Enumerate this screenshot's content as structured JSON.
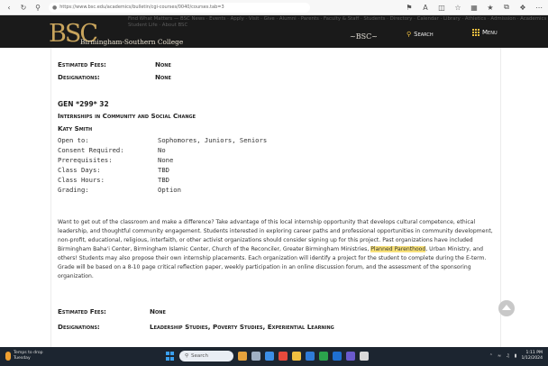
{
  "browser": {
    "url": "https://www.bsc.edu/academics/bulletin/cgi-courses/0040/courses.tab=3",
    "icons": [
      "back-icon",
      "refresh-icon",
      "translate-icon",
      "favorite-icon",
      "collections-icon",
      "split-icon",
      "favorites-bar-icon",
      "extensions-icon",
      "more-icon"
    ]
  },
  "header": {
    "ghost_text": "Find What Matters — BSC News · Events · Apply · Visit · Give · Alumni · Parents · Faculty & Staff · Students · Directory · Calendar · Library · Athletics · Admission · Academics · Student Life · About BSC",
    "logo": "BSC",
    "college_name": "Birmingham-Southern College",
    "logo_mark": "~BSC~",
    "search_label": "Search",
    "menu_label": "Menu",
    "accent": "#f0c040"
  },
  "prev_course": {
    "fees_label": "Estimated Fees:",
    "fees_value": "None",
    "designations_label": "Designations:",
    "designations_value": "None"
  },
  "course": {
    "number": "GEN *299* 32",
    "title": "Internships in Community and Social Change",
    "instructor": "Katy Smith",
    "attributes": [
      {
        "label": "Open to:",
        "value": "Sophomores, Juniors, Seniors"
      },
      {
        "label": "Consent Required:",
        "value": "No"
      },
      {
        "label": "Prerequisites:",
        "value": "None"
      },
      {
        "label": "Class Days:",
        "value": "TBD"
      },
      {
        "label": "Class Hours:",
        "value": "TBD"
      },
      {
        "label": "Grading:",
        "value": "Option"
      }
    ],
    "desc_part1": "Want to get out of the classroom and make a difference? Take advantage of this local internship opportunity that develops cultural competence, ethical leadership, and thoughtful community engagement. Students interested in exploring career paths and professional opportunities in community development, non-profit, educational, religious, interfaith, or other activist organizations should consider signing up for this project. Past organizations have included Birmingham Baha'i Center, Birmingham Islamic Center, Church of the Reconciler, Greater Birmingham Ministries, ",
    "desc_highlight": "Planned Parenthood",
    "desc_part2": ", Urban Ministry, and others! Students may also propose their own internship placements. Each organization will identify a project for the student to complete during the E-term. Grade will be based on a 8-10 page critical reflection paper, weekly participation in an online discussion forum, and the assessment of the sponsoring organization.",
    "fees_label": "Estimated Fees:",
    "fees_value": "None",
    "designations_label": "Designations:",
    "designations_value": "Leadership Studies, Poverty Studies, Experiential Learning"
  },
  "taskbar": {
    "weather_line1": "Temps to drop",
    "weather_line2": "Tuesday",
    "search_placeholder": "Search",
    "time": "1:11 PM",
    "date": "1/12/2024"
  }
}
